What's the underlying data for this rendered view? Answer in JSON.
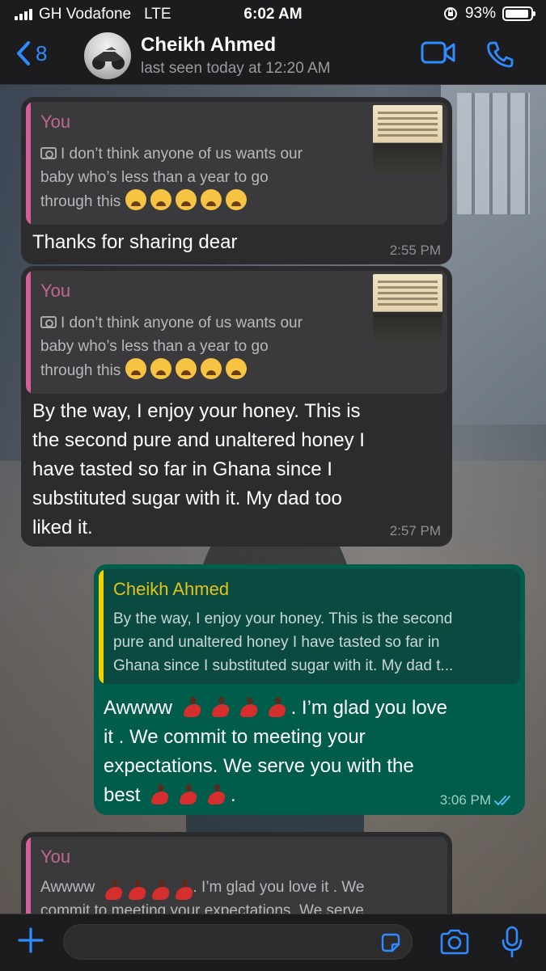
{
  "status_bar": {
    "carrier": "GH Vodafone",
    "network": "LTE",
    "time": "6:02 AM",
    "battery": "93%",
    "battery_level": 0.93
  },
  "header": {
    "back_count": "8",
    "contact_name": "Cheikh Ahmed",
    "last_seen": "last seen today at 12:20 AM"
  },
  "messages": [
    {
      "direction": "incoming",
      "quote": {
        "author": "You",
        "line1": "I don’t think anyone of us wants our",
        "line2": "baby who’s less than a year to go",
        "line3": "through this",
        "emoji_count": 5
      },
      "text_lines": [
        "Thanks for sharing dear"
      ],
      "time": "2:55 PM"
    },
    {
      "direction": "incoming",
      "quote": {
        "author": "You",
        "line1": "I don’t think anyone of us wants our",
        "line2": "baby who’s less than a year to go",
        "line3": "through this",
        "emoji_count": 5
      },
      "text_lines": [
        "By the way, I enjoy your honey. This is",
        "the second pure and unaltered honey I",
        "have tasted so far in Ghana since I",
        "substituted sugar with it. My dad too",
        "liked it."
      ],
      "time": "2:57 PM"
    },
    {
      "direction": "outgoing",
      "quote": {
        "author": "Cheikh Ahmed",
        "line1": "By the way, I enjoy your honey. This is the second",
        "line2": "pure and unaltered honey I have tasted so far in",
        "line3": "Ghana since I substituted sugar with it. My dad t..."
      },
      "text_lines": [
        "Awwww",
        ". I’m glad you love",
        "it . We commit to meeting your",
        "expectations. We serve you with the",
        "best",
        "."
      ],
      "time": "3:06 PM",
      "read": "read-receipt-double-check"
    },
    {
      "direction": "incoming",
      "quote": {
        "author": "You",
        "line1a": "Awwww",
        "line1b": ". I’m glad you love it . We",
        "line2": "commit to meeting your expectations. We serve"
      }
    }
  ],
  "colors": {
    "incoming_bubble": "#2c2c2e",
    "outgoing_bubble": "#005c4b",
    "quote_you_bar": "#d45f9b",
    "quote_you_author": "#c2678f",
    "quote_cheikh_bar": "#f2d100",
    "quote_cheikh_author": "#e3c21a",
    "ios_blue": "#2f8cff"
  },
  "icons": [
    "back-chevron-icon",
    "video-call-icon",
    "phone-call-icon",
    "camera-icon",
    "plus-icon",
    "sticker-icon",
    "microphone-icon",
    "double-check-icon",
    "weary-face-emoji",
    "dancer-emoji"
  ]
}
